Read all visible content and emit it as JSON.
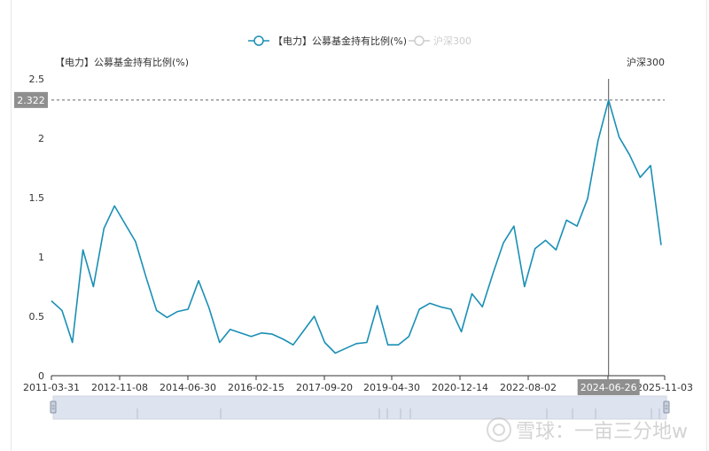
{
  "legend": {
    "series1": "【电力】公募基金持有比例(%)",
    "series2": "沪深300"
  },
  "axis": {
    "left_name": "【电力】公募基金持有比例(%)",
    "right_name": "沪深300"
  },
  "tooltip": {
    "y_value": "2.322",
    "x_value": "2024-06-26"
  },
  "watermark": "雪球：一亩三分地w",
  "colors": {
    "series1": "#1a8fb5",
    "series2_disabled": "#cccccc",
    "axis": "#333333",
    "crosshair_label_bg": "#8f8f8f",
    "dataZoom_bg": "#dde3ef"
  },
  "chart_data": {
    "type": "line",
    "title": "",
    "xlabel": "",
    "ylabel": "【电力】公募基金持有比例(%)",
    "ylim": [
      0,
      2.5
    ],
    "y_ticks": [
      "0",
      "0.5",
      "1",
      "1.5",
      "2",
      "2.5"
    ],
    "x_ticks": [
      "2011-03-31",
      "2012-11-08",
      "2014-06-30",
      "2016-02-15",
      "2017-09-20",
      "2019-04-30",
      "2020-12-14",
      "2022-08-02",
      "2024-06-26",
      "2025-11-03"
    ],
    "grid": false,
    "legend_position": "top",
    "series": [
      {
        "name": "【电力】公募基金持有比例(%)",
        "values": [
          0.63,
          0.55,
          0.28,
          1.06,
          0.75,
          1.24,
          1.43,
          1.28,
          1.13,
          0.83,
          0.55,
          0.49,
          0.54,
          0.56,
          0.8,
          0.57,
          0.28,
          0.39,
          0.36,
          0.33,
          0.36,
          0.35,
          0.31,
          0.26,
          0.38,
          0.5,
          0.28,
          0.19,
          0.23,
          0.27,
          0.28,
          0.59,
          0.26,
          0.26,
          0.33,
          0.56,
          0.61,
          0.58,
          0.56,
          0.37,
          0.69,
          0.58,
          0.86,
          1.12,
          1.26,
          0.75,
          1.07,
          1.14,
          1.06,
          1.31,
          1.26,
          1.49,
          1.98,
          2.322,
          2.01,
          1.86,
          1.67,
          1.77,
          1.1
        ]
      },
      {
        "name": "沪深300",
        "values": []
      }
    ],
    "highlight": {
      "x": "2024-06-26",
      "y": 2.322
    }
  }
}
